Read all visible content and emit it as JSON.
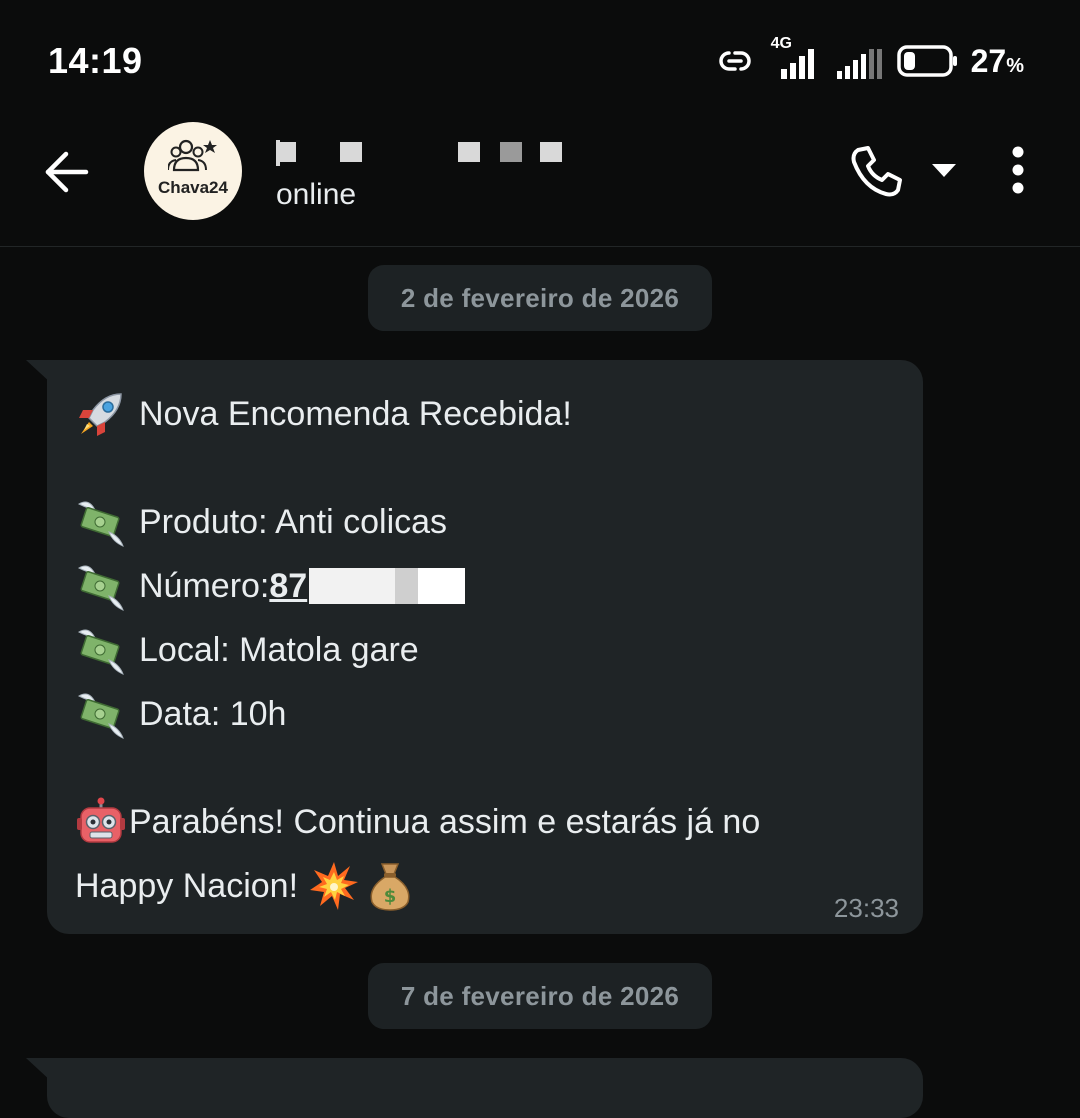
{
  "status_bar": {
    "time": "14:19",
    "network_label": "4G",
    "battery_percent": "27",
    "battery_unit": "%",
    "battery_level": 0.27
  },
  "header": {
    "avatar_text": "Chava24",
    "contact_status": "online"
  },
  "chat": {
    "date_chips": [
      "2 de fevereiro de 2026",
      "7 de fevereiro de 2026"
    ],
    "message": {
      "title": "Nova Encomenda Recebida!",
      "product": "Produto: Anti colicas",
      "number_label": "Número: ",
      "number_value": "87",
      "location": "Local: Matola gare",
      "date_line": "Data: 10h",
      "congrats_1": "Parabéns! Continua assim e estarás já no",
      "congrats_2": "Happy Nacion!",
      "time": "23:33"
    }
  },
  "icons": {
    "back": "arrow-left-icon",
    "call": "phone-icon",
    "more": "kebab-menu-icon",
    "rocket": "rocket-icon",
    "money": "money-with-wings-icon",
    "robot": "robot-icon",
    "boom": "collision-icon",
    "moneybag": "money-bag-icon"
  },
  "colors": {
    "background": "#0b0c0c",
    "bubble": "#1f2426",
    "chip": "#1d2224",
    "secondary_text": "#8d969b",
    "avatar_bg": "#fbf3e4"
  }
}
